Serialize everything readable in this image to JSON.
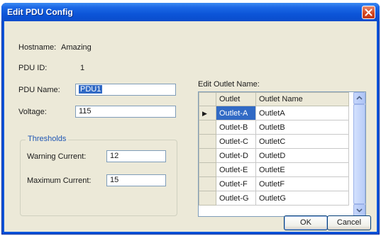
{
  "window": {
    "title": "Edit PDU Config"
  },
  "info": {
    "hostname_label": "Hostname:",
    "hostname_value": "Amazing",
    "pdu_id_label": "PDU ID:",
    "pdu_id_value": "1"
  },
  "fields": {
    "pdu_name_label": "PDU Name:",
    "pdu_name_value": "PDU1",
    "voltage_label": "Voltage:",
    "voltage_value": "115"
  },
  "thresholds": {
    "legend": "Thresholds",
    "warning_label": "Warning Current:",
    "warning_value": "12",
    "maximum_label": "Maximum Current:",
    "maximum_value": "15"
  },
  "outlet_grid": {
    "caption": "Edit Outlet Name:",
    "columns": [
      "Outlet",
      "Outlet Name"
    ],
    "rows": [
      {
        "outlet": "Outlet-A",
        "name": "OutletA"
      },
      {
        "outlet": "Outlet-B",
        "name": "OutletB"
      },
      {
        "outlet": "Outlet-C",
        "name": "OutletC"
      },
      {
        "outlet": "Outlet-D",
        "name": "OutletD"
      },
      {
        "outlet": "Outlet-E",
        "name": "OutletE"
      },
      {
        "outlet": "Outlet-F",
        "name": "OutletF"
      },
      {
        "outlet": "Outlet-G",
        "name": "OutletG"
      }
    ],
    "current_row_indicator": "▶"
  },
  "buttons": {
    "ok": "OK",
    "cancel": "Cancel"
  },
  "icons": {
    "close": "close-icon",
    "row_pointer": "row-pointer-icon",
    "scroll_up": "chevron-up-icon",
    "scroll_down": "chevron-down-icon"
  },
  "colors": {
    "titlebar": "#0a53d9",
    "dialog_face": "#ece9d8",
    "selection": "#316ac5",
    "close_button": "#d2431c"
  }
}
